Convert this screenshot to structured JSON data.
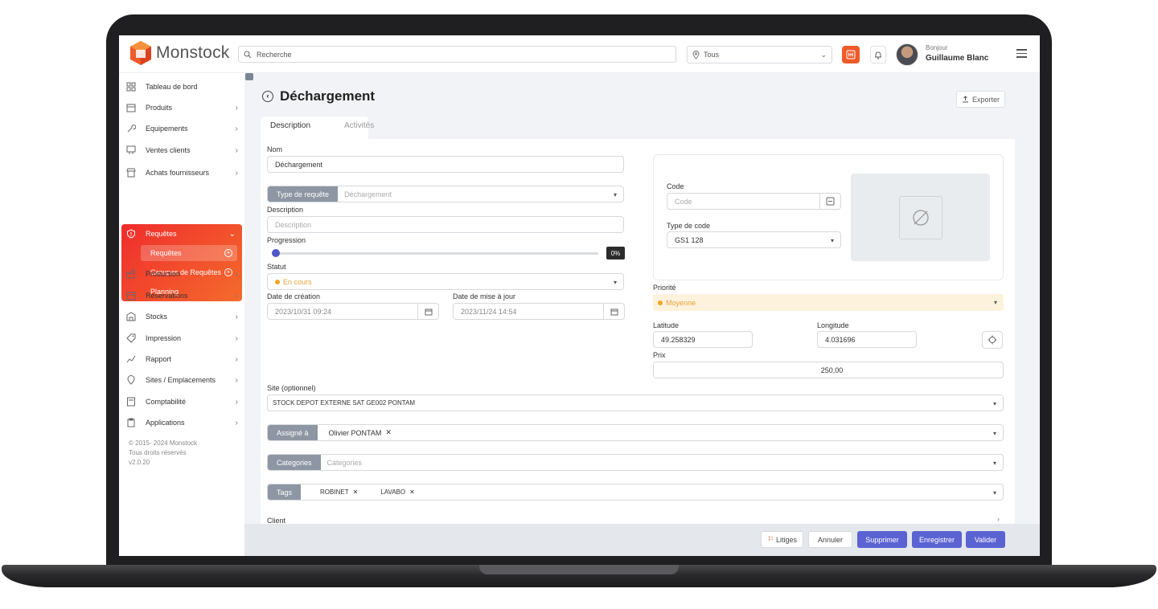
{
  "app": {
    "brand": "Monstock"
  },
  "header": {
    "search_placeholder": "Recherche",
    "location_value": "Tous",
    "greeting": "Bonjour",
    "user_name": "Guillaume Blanc"
  },
  "sidebar": {
    "items": [
      {
        "label": "Tableau de bord",
        "icon": "dashboard-icon"
      },
      {
        "label": "Produits",
        "icon": "box-icon"
      },
      {
        "label": "Equipements",
        "icon": "wrench-icon"
      },
      {
        "label": "Ventes clients",
        "icon": "cart-icon"
      },
      {
        "label": "Achats fournisseurs",
        "icon": "store-icon"
      },
      {
        "label": "Requêtes",
        "icon": "shield-alert-icon"
      },
      {
        "label": "Production",
        "icon": "factory-icon"
      },
      {
        "label": "Réservations",
        "icon": "calendar-icon"
      },
      {
        "label": "Stocks",
        "icon": "warehouse-icon"
      },
      {
        "label": "Impression",
        "icon": "tag-icon"
      },
      {
        "label": "Rapport",
        "icon": "chart-icon"
      },
      {
        "label": "Sites / Emplacements",
        "icon": "pin-icon"
      },
      {
        "label": "Comptabilité",
        "icon": "calculator-icon"
      },
      {
        "label": "Applications",
        "icon": "clipboard-icon"
      }
    ],
    "sub_items": [
      "Requêtes",
      "Groupes de Requêtes",
      "Planning"
    ],
    "copyright": "© 2015- 2024 Monstock",
    "rights": "Tous droits réservés",
    "version": "v2.0.20"
  },
  "page": {
    "title": "Déchargement",
    "export_label": "Exporter",
    "tabs": [
      "Description",
      "Activités"
    ]
  },
  "form": {
    "nom_label": "Nom",
    "nom_value": "Déchargement",
    "type_prefix": "Type de requête",
    "type_value": "Déchargement",
    "description_label": "Description",
    "description_placeholder": "Description",
    "progression_label": "Progression",
    "progression_value": "0%",
    "progression_fraction": 0,
    "statut_label": "Statut",
    "statut_value": "En cours",
    "date_creation_label": "Date de création",
    "date_creation_value": "2023/10/31 09:24",
    "date_maj_label": "Date de mise à jour",
    "date_maj_value": "2023/11/24 14:54",
    "code_label": "Code",
    "code_placeholder": "Code",
    "type_code_label": "Type de code",
    "type_code_value": "GS1 128",
    "priorite_label": "Priorité",
    "priorite_value": "Moyenne",
    "latitude_label": "Latitude",
    "latitude_value": "49.258329",
    "longitude_label": "Longitude",
    "longitude_value": "4.031696",
    "prix_label": "Prix",
    "prix_value": "250,00",
    "site_label": "Site (optionnel)",
    "site_value": "STOCK DEPOT EXTERNE SAT GE002 PONTAM",
    "assigne_prefix": "Assigné à",
    "assigne_value": "Olivier PONTAM",
    "categories_prefix": "Categories",
    "categories_placeholder": "Categories",
    "tags_prefix": "Tags",
    "tags": [
      "ROBINET",
      "LAVABO"
    ],
    "client_label": "Client"
  },
  "actions": {
    "litiges": "Litiges",
    "annuler": "Annuler",
    "supprimer": "Supprimer",
    "enregistrer": "Enregistrer",
    "valider": "Valider"
  },
  "colors": {
    "accent": "#5b63d3",
    "brand_orange": "#ef5a29",
    "active_gradient_start": "#ef2d2d",
    "active_gradient_end": "#f46b2c",
    "priority_bg": "#fdf2dc"
  }
}
